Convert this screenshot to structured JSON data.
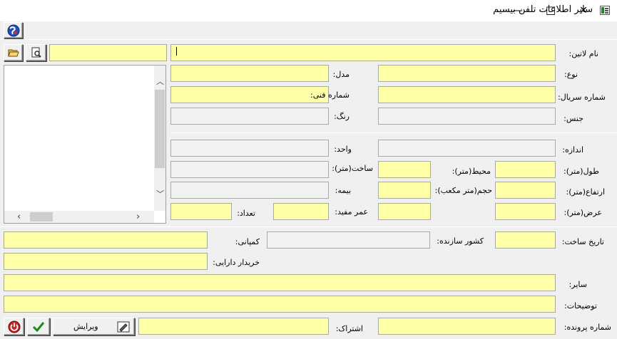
{
  "window": {
    "title": "سایر اطلاعات تلفن بیسیم",
    "minimize": "—",
    "maximize": "☐",
    "close": "✕"
  },
  "toolbar": {
    "globe_icon": "globe-icon"
  },
  "labels": {
    "latin_name": "نام لاتین:",
    "type": "نوع:",
    "model": "مدل:",
    "serial": "شماره سریال:",
    "tech_number": "شماره فنی:",
    "material": "جنس:",
    "color": "رنگ:",
    "size": "اندازه:",
    "unit": "واحد:",
    "length": "طول(متر):",
    "perimeter": "محیط(متر):",
    "building": "ساخت(متر):",
    "height": "ارتفاع(متر):",
    "volume": "حجم(متر مکعب):",
    "insurance": "بیمه:",
    "width": "عرض(متر):",
    "useful_life": "عمر مفید:",
    "count": "تعداد:",
    "build_date": "تاریخ ساخت:",
    "manufacturer_country": "کشور سازنده:",
    "company": "کمپانی:",
    "asset_buyer": "خریدار دارایی:",
    "other": "سایر:",
    "description": "توضیحات:",
    "file_number": "شماره پرونده:",
    "subscription": "اشتراک:"
  },
  "buttons": {
    "edit": "ویرایش"
  },
  "colors": {
    "field_yellow": "#ffffa8",
    "field_gray": "#f2f2f2",
    "window_bg": "#f0f0f0"
  }
}
